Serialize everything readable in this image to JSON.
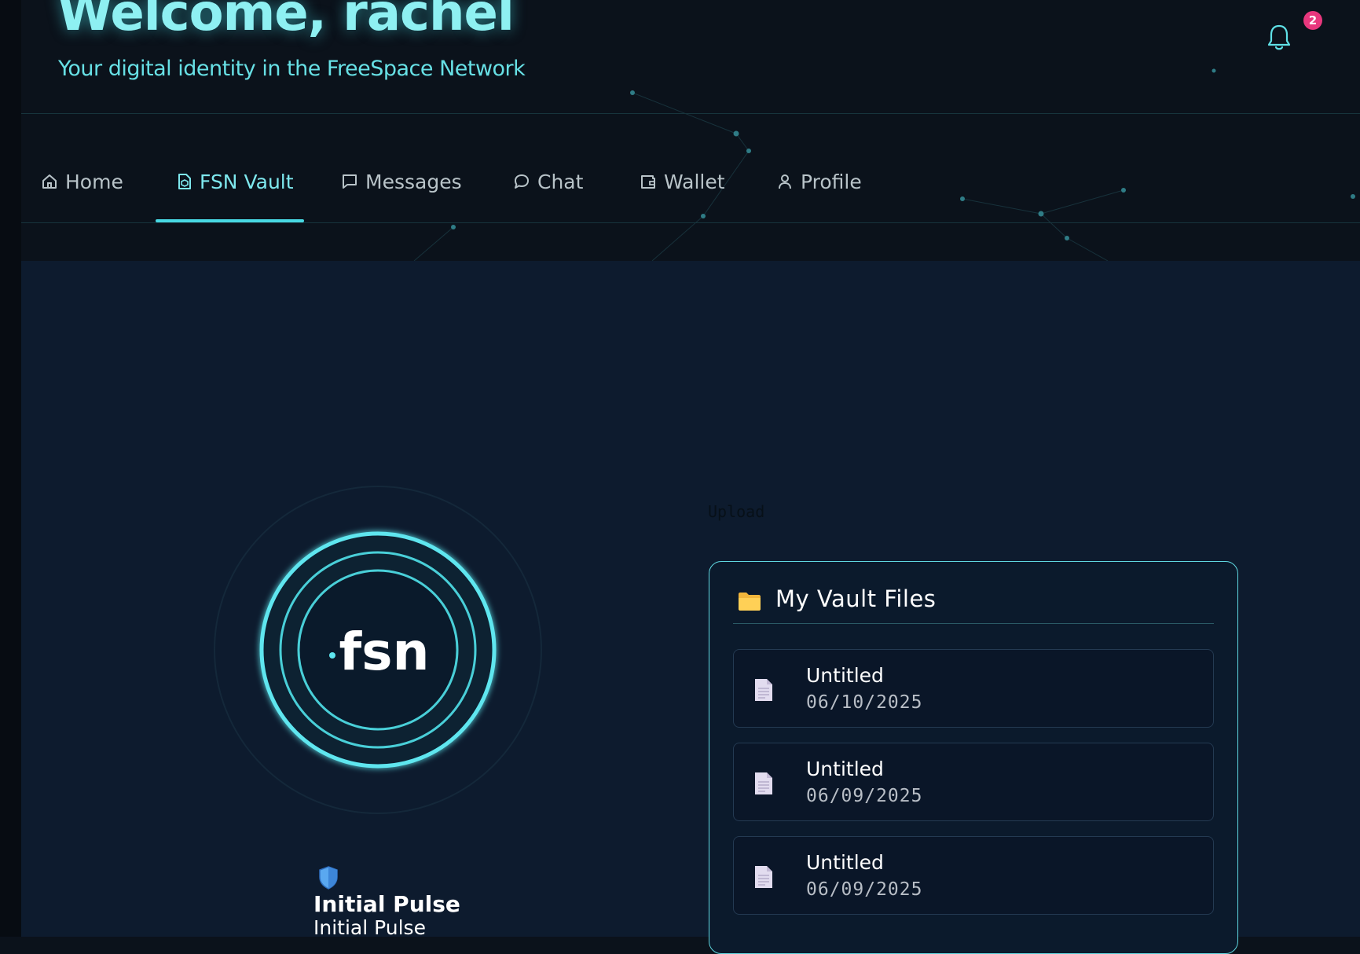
{
  "header": {
    "welcome": "Welcome, rachel",
    "subtitle": "Your digital identity in the FreeSpace Network",
    "notification_count": "2"
  },
  "nav": {
    "items": [
      {
        "label": "Home",
        "icon": "home-icon"
      },
      {
        "label": "FSN Vault",
        "icon": "vault-icon",
        "active": true
      },
      {
        "label": "Messages",
        "icon": "message-square-icon"
      },
      {
        "label": "Chat",
        "icon": "chat-bubble-icon"
      },
      {
        "label": "Wallet",
        "icon": "wallet-icon"
      },
      {
        "label": "Profile",
        "icon": "user-icon"
      }
    ]
  },
  "vault": {
    "upload_label": "Upload",
    "logo_text": "fsn",
    "pulse_title": "Initial Pulse",
    "pulse_subtitle": "Initial Pulse",
    "files_title": "My Vault Files",
    "files": [
      {
        "name": "Untitled",
        "date": "06/10/2025"
      },
      {
        "name": "Untitled",
        "date": "06/09/2025"
      },
      {
        "name": "Untitled",
        "date": "06/09/2025"
      }
    ]
  },
  "colors": {
    "accent": "#48d8e3",
    "background": "#0b121b",
    "panel": "#0d1b2e",
    "badge": "#e8377d"
  }
}
